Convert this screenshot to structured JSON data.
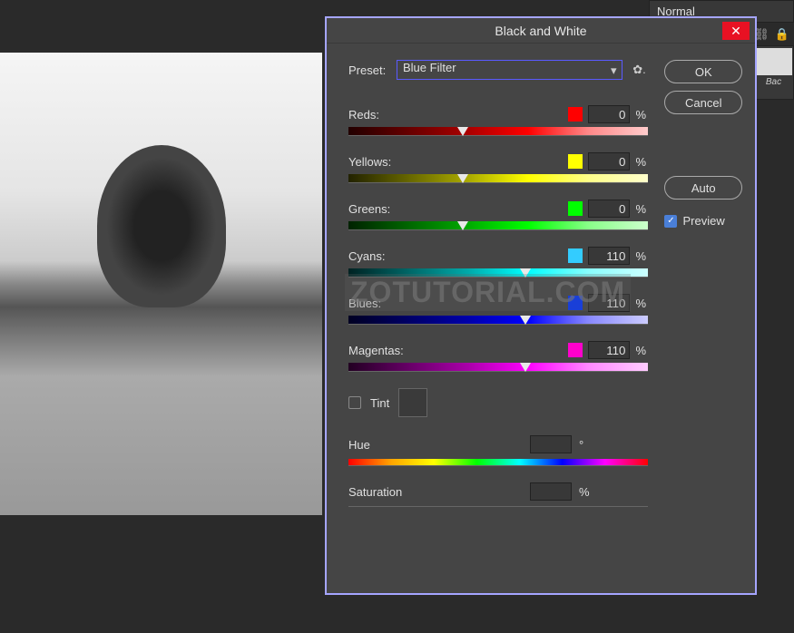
{
  "topbar": {
    "blend_mode": "Normal"
  },
  "layers": {
    "bg_label": "Bac"
  },
  "dialog": {
    "title": "Black and White",
    "preset_label": "Preset:",
    "preset_value": "Blue Filter",
    "ok": "OK",
    "cancel": "Cancel",
    "auto": "Auto",
    "preview": "Preview",
    "preview_checked": true,
    "tint_label": "Tint",
    "tint_checked": false,
    "hue_label": "Hue",
    "hue_value": "",
    "hue_unit": "°",
    "sat_label": "Saturation",
    "sat_value": "",
    "sat_unit": "%"
  },
  "colors": [
    {
      "label": "Reds:",
      "swatch": "#ff0000",
      "value": "0",
      "pos": 38,
      "grad": "g-red"
    },
    {
      "label": "Yellows:",
      "swatch": "#ffff00",
      "value": "0",
      "pos": 38,
      "grad": "g-yellow"
    },
    {
      "label": "Greens:",
      "swatch": "#00ff00",
      "value": "0",
      "pos": 38,
      "grad": "g-green"
    },
    {
      "label": "Cyans:",
      "swatch": "#33ccff",
      "value": "110",
      "pos": 59,
      "grad": "g-cyan"
    },
    {
      "label": "Blues:",
      "swatch": "#0033ff",
      "value": "110",
      "pos": 59,
      "grad": "g-blue"
    },
    {
      "label": "Magentas:",
      "swatch": "#ff00cc",
      "value": "110",
      "pos": 59,
      "grad": "g-magenta"
    }
  ],
  "watermark": "ZOTUTORIAL.COM"
}
